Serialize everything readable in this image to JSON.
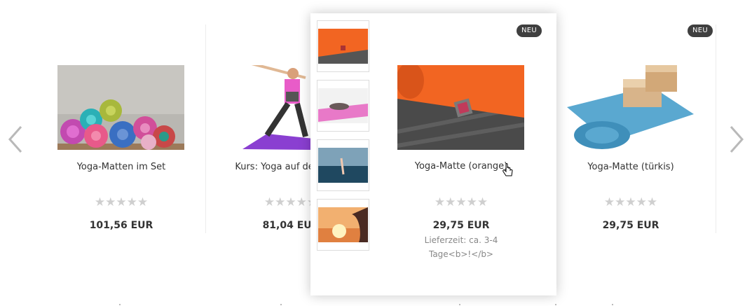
{
  "carousel": {
    "prev_icon": "chevron-left-icon",
    "next_icon": "chevron-right-icon",
    "products": [
      {
        "name": "Yoga-Matten im Set",
        "stars": "★★★★★",
        "price": "101,56 EUR",
        "badge": ""
      },
      {
        "name": "Kurs: Yoga auf der Matte",
        "stars": "★★★★★",
        "price": "81,04 EUR",
        "badge": ""
      },
      {
        "name": "Yoga-Matte (orange)",
        "stars": "★★★★★",
        "price": "29,75 EUR",
        "badge": "NEU"
      },
      {
        "name": "Yoga-Matte (türkis)",
        "stars": "★★★★★",
        "price": "29,75 EUR",
        "badge": "NEU"
      }
    ]
  },
  "popup": {
    "name": "Yoga-Matte (orange)",
    "stars": "★★★★★",
    "price": "29,75 EUR",
    "delivery": "Lieferzeit: ca. 3-4 Tage<b>!</b>",
    "badge": "NEU",
    "thumbnails": [
      "orange mat",
      "pink mat pose",
      "beach yoga",
      "sunset meditation"
    ]
  },
  "colors": {
    "badge_bg": "#3f3f3f",
    "star_empty": "#cfcfcf",
    "accent_orange": "#f26522",
    "teal_mat": "#5aa8d0"
  }
}
